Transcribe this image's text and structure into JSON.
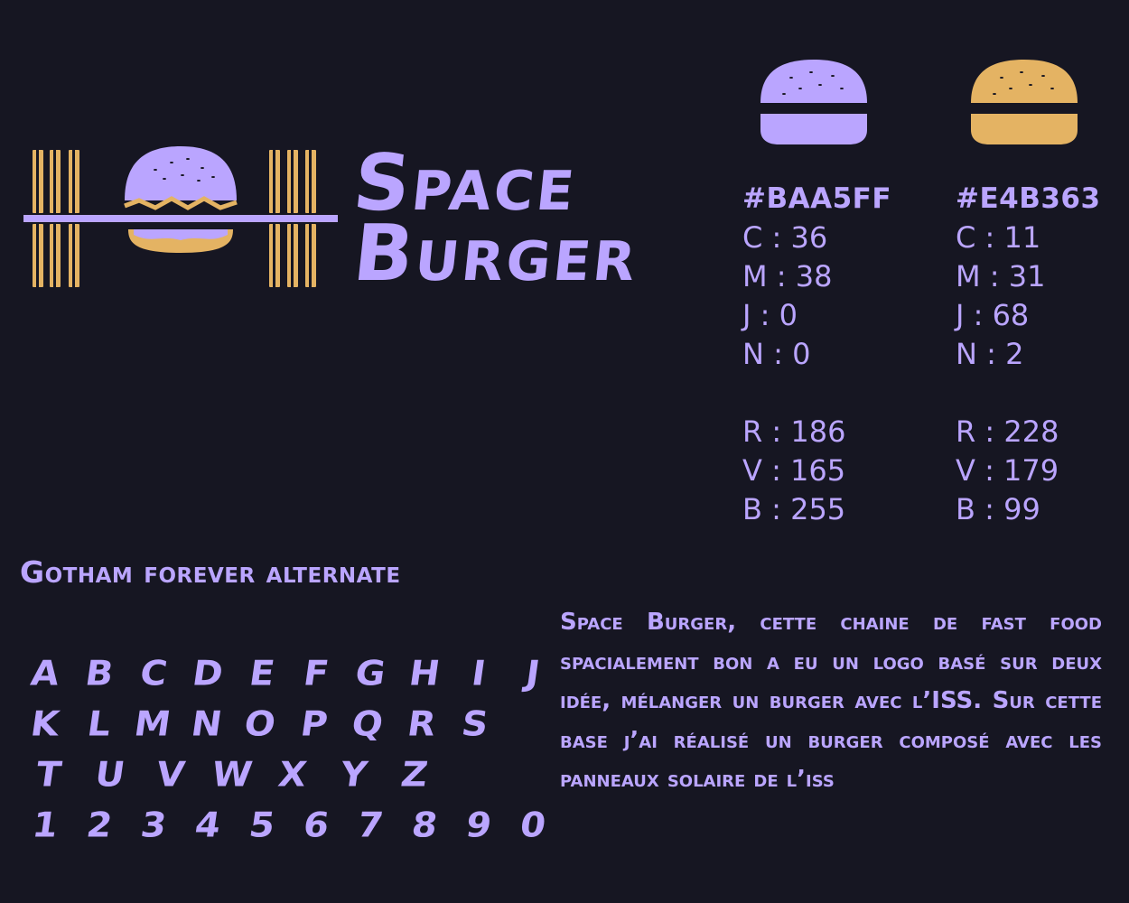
{
  "brand": {
    "name_line1": "Space",
    "name_line2": "Burger"
  },
  "colors": {
    "background": "#161622",
    "purple": "#BAA5FF",
    "yellow": "#E4B363"
  },
  "palette": [
    {
      "hex": "#BAA5FF",
      "c": "C : 36",
      "m": "M : 38",
      "j": "J : 0",
      "n": "N  : 0",
      "r": "R : 186",
      "v": "V : 165",
      "b": "B : 255"
    },
    {
      "hex": "#E4B363",
      "c": "C : 11",
      "m": "M : 31",
      "j": "J : 68",
      "n": "N  : 2",
      "r": "R : 228",
      "v": "V : 179",
      "b": "B : 99"
    }
  ],
  "typography": {
    "font_label": "Gotham forever alternate",
    "rows": [
      [
        "A",
        "B",
        "C",
        "D",
        "E",
        "F",
        "G",
        "H",
        "I",
        "J"
      ],
      [
        "K",
        "L",
        "M",
        "N",
        "O",
        "P",
        "Q",
        "R",
        "S"
      ],
      [
        "T",
        "U",
        "V",
        "W",
        "X",
        "Y",
        "Z"
      ],
      [
        "1",
        "2",
        "3",
        "4",
        "5",
        "6",
        "7",
        "8",
        "9",
        "0"
      ]
    ]
  },
  "description": "Space Burger, cette chaine de fast food spacialement bon a eu un logo basé sur deux idée, mélanger un burger avec l’ISS. Sur cette base j’ai réalisé un burger composé avec les panneaux solaire de l’iss",
  "icons": {
    "logo": "iss-burger-icon",
    "swatch_purple": "purple-burger-bun-icon",
    "swatch_yellow": "yellow-burger-bun-icon"
  }
}
